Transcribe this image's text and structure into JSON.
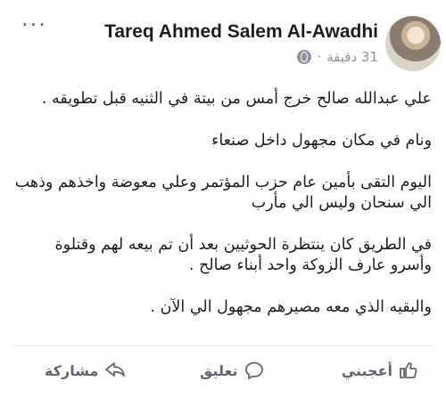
{
  "post": {
    "author": "Tareq Ahmed Salem Al-Awadhi",
    "time": "31 دقيقة",
    "privacy_icon": "globe-icon",
    "more_label": "···",
    "paragraphs": [
      "علي عبدالله صالح خرج أمس من بيتة في الثنيه قبل تطويقه  .",
      "ونام في مكان مجهول داخل صنعاء",
      "اليوم التقى بأمين عام حزب المؤتمر وعلي معوضة واخذهم وذهب الي سنحان وليس الي مأرب",
      "في الطريق كان ينتظرة الحوثيين بعد أن تم بيعه لهم وقتلوة وأسرو عارف الزوكة واحد أبناء صالح   .",
      "والبقيه الذي معه مصيرهم مجهول الي الآن  ."
    ]
  },
  "actions": {
    "like_label": "أعجبني",
    "comment_label": "تعليق",
    "share_label": "مشاركة"
  },
  "colors": {
    "text": "#1c1e21",
    "muted": "#90949c",
    "action": "#606770"
  }
}
